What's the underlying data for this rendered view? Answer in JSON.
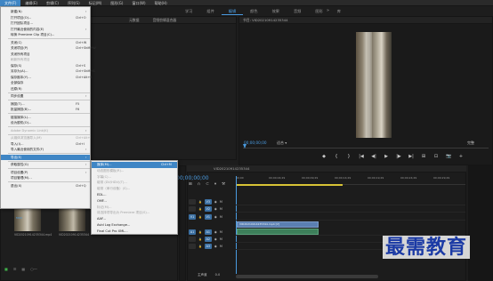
{
  "menubar": {
    "items": [
      {
        "label": "文件(F)",
        "active": true
      },
      {
        "label": "编辑(E)"
      },
      {
        "label": "剪辑(C)"
      },
      {
        "label": "序列(S)"
      },
      {
        "label": "标记(M)"
      },
      {
        "label": "图形(G)"
      },
      {
        "label": "窗口(W)"
      },
      {
        "label": "帮助(H)"
      }
    ]
  },
  "workspaces": {
    "items": [
      "学习",
      "组件",
      "编辑",
      "颜色",
      "效果",
      "音频",
      "图形",
      "库"
    ],
    "active": "编辑",
    "more": "»"
  },
  "source_panel": {
    "tabs": [
      "元数据",
      "音频剪辑混合器"
    ]
  },
  "program_panel": {
    "title": "节目: VID20210914235344",
    "timecode": "00;00;00;00",
    "fit": "适合",
    "quality": "完整"
  },
  "transport": [
    "◆",
    "{",
    "}",
    "|◀",
    "◀|",
    "▶",
    "|▶",
    "▶|",
    "⊞",
    "⊡",
    "📷",
    "+"
  ],
  "project_panel": {
    "thumb1_label": "VID20210914235344.mp4",
    "thumb2_label": "VID20210914235344",
    "thumb1_badge": "MOV"
  },
  "timeline": {
    "title": "VID20210914235344",
    "timecode": "00;00;00;00",
    "ticks": [
      "00;00",
      "00;00;04;29",
      "00;00;09;29",
      "00;00;14;29",
      "00;00;19;29",
      "00;00;24;29",
      "00;00;29;29"
    ],
    "tracks": [
      {
        "target": "",
        "name": "V3"
      },
      {
        "target": "",
        "name": "V2"
      },
      {
        "target": "V1",
        "name": "V1"
      },
      {
        "target": "A1",
        "name": "A1"
      },
      {
        "target": "",
        "name": "A2"
      },
      {
        "target": "",
        "name": "A3"
      }
    ],
    "clip_v1": "VID20210914235344.mp4 [V]",
    "clip_a1": "",
    "master_label": "主声道",
    "master_value": "0.0"
  },
  "file_menu": {
    "items": [
      {
        "label": "新建(N)",
        "shortcut": "",
        "submenu": true,
        "disabled": false
      },
      {
        "label": "打开项目(O)...",
        "shortcut": "Ctrl+O",
        "disabled": false
      },
      {
        "label": "打开团队项目...",
        "shortcut": "",
        "disabled": false
      },
      {
        "label": "打开最近使用的内容(E)",
        "shortcut": "",
        "submenu": true,
        "disabled": false
      },
      {
        "label": "转换 Premiere Clip 项目(C)...",
        "shortcut": "",
        "disabled": false
      },
      {
        "sep": true
      },
      {
        "label": "关闭(C)",
        "shortcut": "Ctrl+W",
        "disabled": false
      },
      {
        "label": "关闭项目(P)",
        "shortcut": "Ctrl+Shift+W",
        "disabled": false
      },
      {
        "label": "关闭所有项目",
        "shortcut": "",
        "disabled": false
      },
      {
        "label": "刷新所有项目",
        "shortcut": "",
        "disabled": true
      },
      {
        "label": "保存(S)",
        "shortcut": "Ctrl+S",
        "disabled": false
      },
      {
        "label": "另存为(A)...",
        "shortcut": "Ctrl+Shift+S",
        "disabled": false
      },
      {
        "label": "保存副本(Y)...",
        "shortcut": "Ctrl+Alt+S",
        "disabled": false
      },
      {
        "label": "全部保存",
        "shortcut": "",
        "disabled": false
      },
      {
        "label": "还原(R)",
        "shortcut": "",
        "disabled": false
      },
      {
        "sep": true
      },
      {
        "label": "同步设置",
        "shortcut": "",
        "submenu": true,
        "disabled": false
      },
      {
        "sep": true
      },
      {
        "label": "捕捉(T)...",
        "shortcut": "F5",
        "disabled": false
      },
      {
        "label": "批量捕捉(B)...",
        "shortcut": "F6",
        "disabled": false
      },
      {
        "sep": true
      },
      {
        "label": "链接媒体(L)...",
        "shortcut": "",
        "disabled": false
      },
      {
        "label": "设为脱机(O)...",
        "shortcut": "",
        "disabled": false
      },
      {
        "sep": true
      },
      {
        "label": "Adobe Dynamic Link(K)",
        "shortcut": "",
        "submenu": true,
        "disabled": true
      },
      {
        "sep": true
      },
      {
        "label": "从媒体浏览器导入(M)",
        "shortcut": "Ctrl+Alt+I",
        "disabled": true
      },
      {
        "label": "导入(I)...",
        "shortcut": "Ctrl+I",
        "disabled": false
      },
      {
        "label": "导入最近使用的文件(F)",
        "shortcut": "",
        "submenu": true,
        "disabled": false
      },
      {
        "sep": true
      },
      {
        "label": "导出(E)",
        "shortcut": "",
        "submenu": true,
        "disabled": false,
        "highlight": true
      },
      {
        "sep": true
      },
      {
        "label": "获取属性(G)",
        "shortcut": "",
        "submenu": true,
        "disabled": false
      },
      {
        "sep": true
      },
      {
        "label": "项目设置(P)",
        "shortcut": "",
        "submenu": true,
        "disabled": false
      },
      {
        "label": "项目管理(M)...",
        "shortcut": "",
        "disabled": false
      },
      {
        "sep": true
      },
      {
        "label": "退出(X)",
        "shortcut": "Ctrl+Q",
        "disabled": false
      }
    ]
  },
  "export_menu": {
    "items": [
      {
        "label": "媒体(M)...",
        "shortcut": "Ctrl+M",
        "disabled": false,
        "highlight": true
      },
      {
        "label": "动态图形模板(R)...",
        "shortcut": "",
        "disabled": true
      },
      {
        "label": "字幕(C)...",
        "shortcut": "",
        "disabled": true
      },
      {
        "label": "磁带 (DV/HDV)(T)...",
        "shortcut": "",
        "disabled": true
      },
      {
        "label": "磁带（串行设备）(S)...",
        "shortcut": "",
        "disabled": true
      },
      {
        "label": "EDL...",
        "shortcut": "",
        "disabled": false
      },
      {
        "label": "OMF...",
        "shortcut": "",
        "disabled": false
      },
      {
        "label": "标记(M)...",
        "shortcut": "",
        "disabled": true
      },
      {
        "label": "将选择项导出为 Premiere 项目(S)...",
        "shortcut": "",
        "disabled": true
      },
      {
        "label": "AAF...",
        "shortcut": "",
        "disabled": false
      },
      {
        "label": "Avid Log Exchange...",
        "shortcut": "",
        "disabled": false
      },
      {
        "label": "Final Cut Pro XML...",
        "shortcut": "",
        "disabled": false
      }
    ]
  },
  "watermark": "最需教育",
  "colors": {
    "accent": "#3f86c5",
    "timecode": "#4a9be0",
    "work_area": "#d7c235",
    "watermark": "#1b3aa5"
  }
}
